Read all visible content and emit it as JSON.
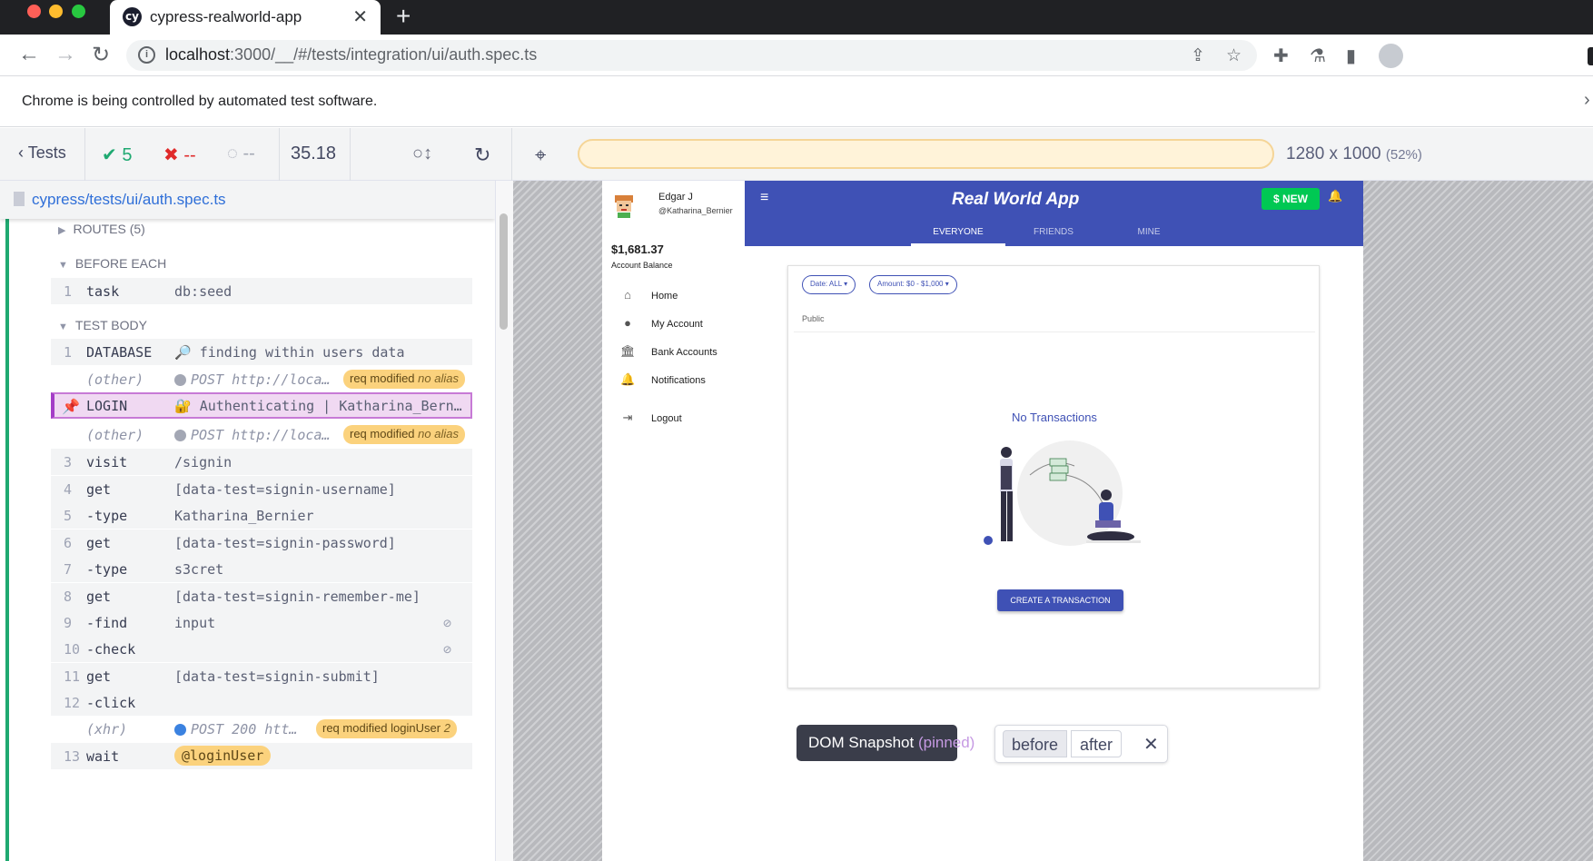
{
  "browser": {
    "tab_title": "cypress-realworld-app",
    "url_host": "localhost",
    "url_path": ":3000/__/#/tests/integration/ui/auth.spec.ts",
    "infobar_text": "Chrome is being controlled by automated test software."
  },
  "cypress_header": {
    "tests_label": "Tests",
    "passed": "5",
    "failed": "--",
    "pending": "--",
    "duration": "35.18",
    "viewport": "1280 x 1000",
    "scale": "(52%)"
  },
  "reporter": {
    "spec_path": "cypress/tests/ui/auth.spec.ts",
    "routes_label": "ROUTES (5)",
    "before_each_label": "BEFORE EACH",
    "test_body_label": "TEST BODY",
    "before_each_cmds": [
      {
        "num": "1",
        "name": "task",
        "msg": "db:seed"
      }
    ],
    "commands": [
      {
        "num": "1",
        "name": "DATABASE",
        "msg": "🔎 finding within users data"
      },
      {
        "num": "",
        "name": "(other)",
        "msg": "POST http://loca…",
        "badge": "req modified",
        "badge_alias": "no alias"
      },
      {
        "num": "",
        "name": "LOGIN",
        "msg": "🔐 Authenticating | Katharina_Bern…"
      },
      {
        "num": "",
        "name": "(other)",
        "msg": "POST http://loca…",
        "badge": "req modified",
        "badge_alias": "no alias"
      },
      {
        "num": "3",
        "name": "visit",
        "msg": "/signin"
      },
      {
        "num": "4",
        "name": "get",
        "msg": "[data-test=signin-username]"
      },
      {
        "num": "5",
        "name": "-type",
        "msg": "Katharina_Bernier"
      },
      {
        "num": "6",
        "name": "get",
        "msg": "[data-test=signin-password]"
      },
      {
        "num": "7",
        "name": "-type",
        "msg": "s3cret"
      },
      {
        "num": "8",
        "name": "get",
        "msg": "[data-test=signin-remember-me]"
      },
      {
        "num": "9",
        "name": "-find",
        "msg": "input"
      },
      {
        "num": "10",
        "name": "-check",
        "msg": ""
      },
      {
        "num": "11",
        "name": "get",
        "msg": "[data-test=signin-submit]"
      },
      {
        "num": "12",
        "name": "-click",
        "msg": ""
      },
      {
        "num": "",
        "name": "(xhr)",
        "msg": "POST 200 htt…",
        "badge": "req modified",
        "badge_alias": "loginUser",
        "badge_count": "2"
      },
      {
        "num": "13",
        "name": "wait",
        "msg": "@loginUser"
      }
    ]
  },
  "app": {
    "user_name": "Edgar J",
    "user_handle": "@Katharina_Bernier",
    "balance": "$1,681.37",
    "balance_label": "Account Balance",
    "title": "Real World App",
    "new_button": "$ NEW",
    "tabs": [
      "EVERYONE",
      "FRIENDS",
      "MINE"
    ],
    "nav": [
      "Home",
      "My Account",
      "Bank Accounts",
      "Notifications",
      "Logout"
    ],
    "filter_date": "Date: ALL",
    "filter_amount": "Amount: $0 - $1,000",
    "list_label": "Public",
    "empty_text": "No Transactions",
    "create_button": "CREATE A TRANSACTION"
  },
  "snapshot": {
    "label": "DOM Snapshot",
    "pinned": "(pinned)",
    "before": "before",
    "after": "after"
  },
  "colors": {
    "cypress_green": "#1fa971",
    "cypress_red": "#e02a2a",
    "app_primary": "#3f51b5",
    "new_green": "#00c853",
    "badge_yellow": "#fbd27d",
    "pinned_purple": "#a43ec7"
  }
}
